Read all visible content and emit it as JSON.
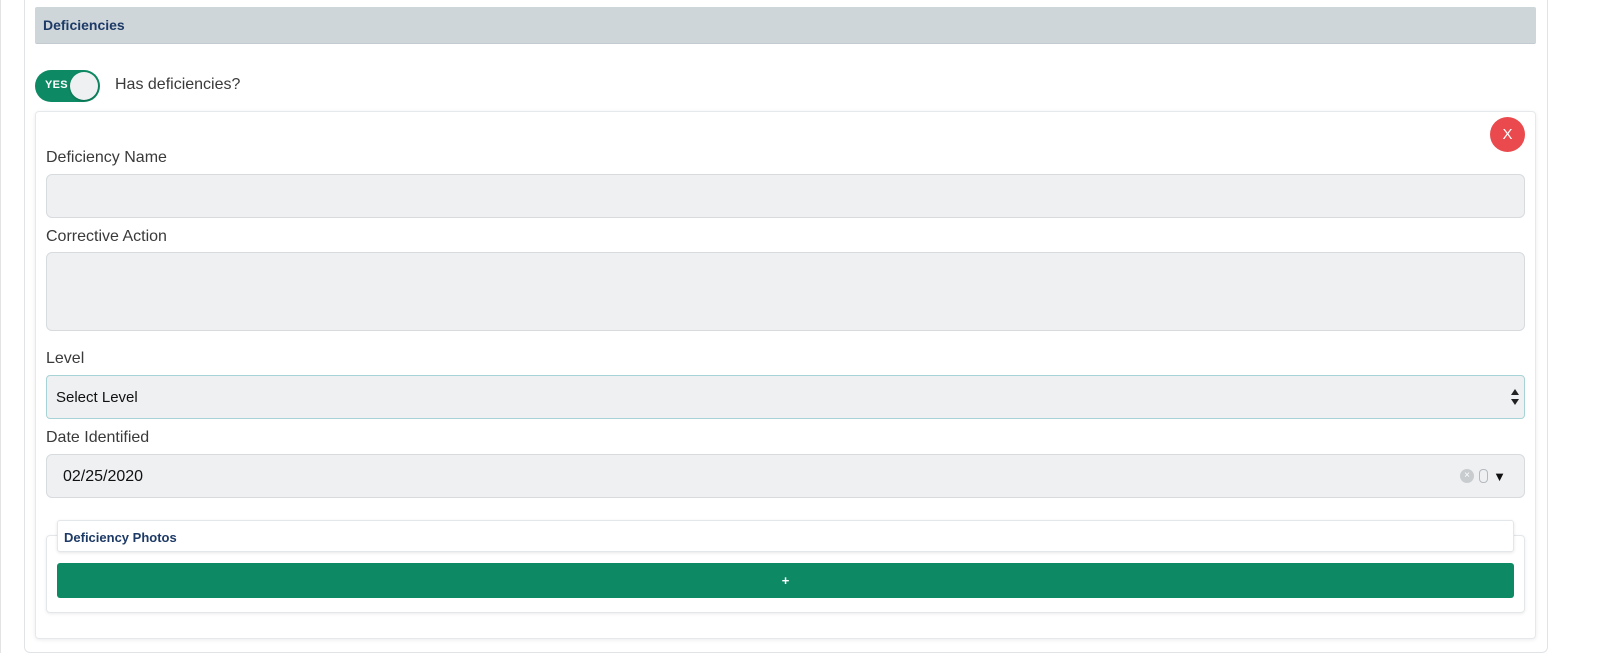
{
  "section": {
    "title": "Deficiencies"
  },
  "toggle": {
    "label": "YES",
    "caption": "Has deficiencies?",
    "checked": true
  },
  "deficiency": {
    "remove_label": "X",
    "name_label": "Deficiency Name",
    "name_value": "",
    "action_label": "Corrective Action",
    "action_value": "",
    "level_label": "Level",
    "level_selected": "Select Level",
    "date_label": "Date Identified",
    "date_value": "02/25/2020"
  },
  "photos": {
    "title": "Deficiency Photos",
    "add_label": "+"
  },
  "colors": {
    "accent_green": "#0d8a63",
    "danger_red": "#ea4a4d",
    "header_bg": "#cfd6da",
    "title_navy": "#1d3a66"
  }
}
